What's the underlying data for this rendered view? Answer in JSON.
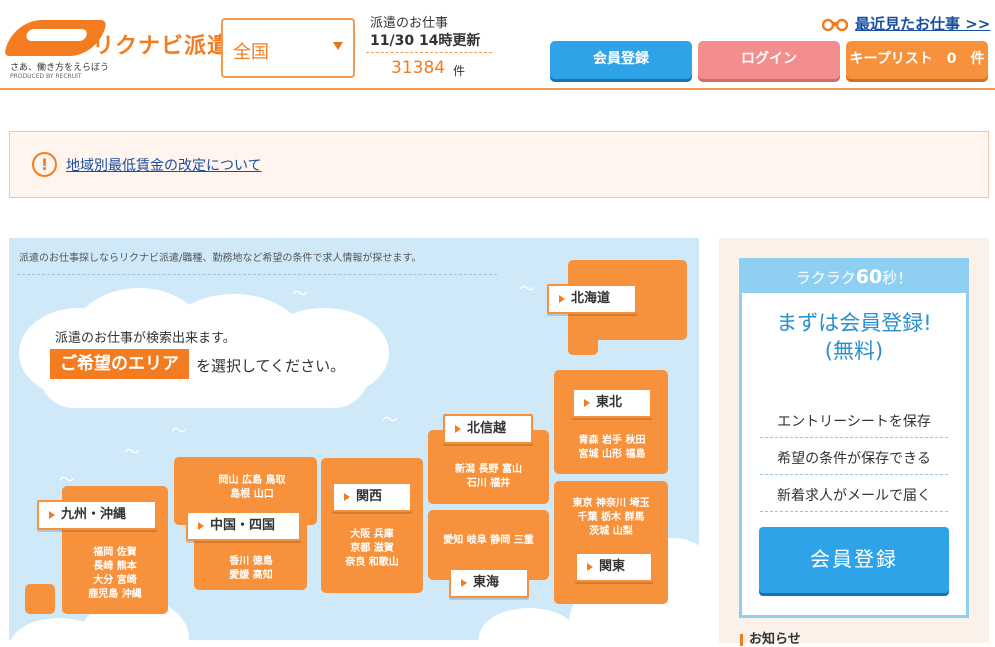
{
  "header": {
    "logo_text": "リクナビ派遣",
    "logo_tagline": "さあ、働き方をえらぼう",
    "logo_produced": "PRODUCED BY RECRUIT",
    "region_select": {
      "value": "全国"
    },
    "job_info": {
      "label": "派遣のお仕事",
      "updated": "11/30 14時更新",
      "count": "31384",
      "count_unit": "件"
    },
    "recent_link": "最近見たお仕事 >>",
    "buttons": {
      "register": "会員登録",
      "login": "ログイン",
      "keeplist": "キープリスト　0　件"
    }
  },
  "notice": {
    "link": "地域別最低賃金の改定について",
    "icon": "exclamation-icon"
  },
  "map": {
    "intro": "派遣のお仕事探しならリクナビ派遣/職種、勤務地など希望の条件で求人情報が探せます。",
    "cloud_text1": "派遣のお仕事が検索出来ます。",
    "cloud_area": "ご希望のエリア",
    "cloud_text2": "を選択してください。",
    "regions": {
      "hokkaido": {
        "label": "北海道",
        "prefs": []
      },
      "tohoku": {
        "label": "東北",
        "prefs": [
          "青森",
          "岩手",
          "秋田",
          "宮城",
          "山形",
          "福島"
        ]
      },
      "hokushinetsu": {
        "label": "北信越",
        "prefs": [
          "新潟",
          "長野",
          "富山",
          "石川",
          "福井"
        ]
      },
      "kanto": {
        "label": "関東",
        "prefs": [
          "東京",
          "神奈川",
          "埼玉",
          "千葉",
          "栃木",
          "群馬",
          "茨城",
          "山梨"
        ]
      },
      "tokai": {
        "label": "東海",
        "prefs": [
          "愛知",
          "岐阜",
          "静岡",
          "三重"
        ]
      },
      "kansai": {
        "label": "関西",
        "prefs": [
          "大阪",
          "兵庫",
          "京都",
          "滋賀",
          "奈良",
          "和歌山"
        ]
      },
      "chugoku_shikoku": {
        "label": "中国・四国",
        "prefs": [
          "岡山",
          "広島",
          "鳥取",
          "島根",
          "山口",
          "香川",
          "徳島",
          "愛媛",
          "高知"
        ]
      },
      "kyushu": {
        "label": "九州・沖縄",
        "prefs": [
          "福岡",
          "佐賀",
          "長崎",
          "熊本",
          "大分",
          "宮崎",
          "鹿児島",
          "沖縄"
        ]
      }
    }
  },
  "register_box": {
    "top_prefix": "ラクラク",
    "top_num": "60",
    "top_suffix": "秒！",
    "headline1": "まずは会員登録!",
    "headline2": "(無料)",
    "features": [
      "エントリーシートを保存",
      "希望の条件が保存できる",
      "新着求人がメールで届く"
    ],
    "button": "会員登録"
  },
  "news_heading": "お知らせ",
  "colors": {
    "accent": "#f47c20",
    "blue": "#2ea3e8",
    "pink": "#f48d8d",
    "map_bg": "#cfe9f9"
  }
}
